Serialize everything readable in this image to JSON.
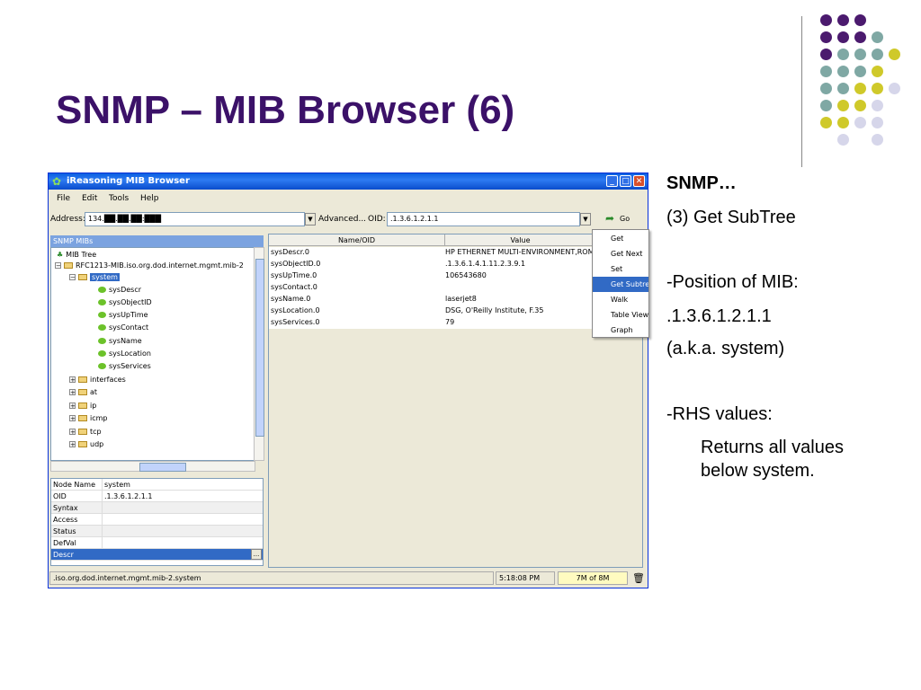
{
  "slide": {
    "title": "SNMP – MIB Browser (6)",
    "notes": {
      "heading": "SNMP…",
      "step": "(3) Get SubTree",
      "position_label": "-Position of MIB:",
      "position_oid": ".1.3.6.1.2.1.1",
      "aka": "(a.k.a. system)",
      "rhs_label": "-RHS values:",
      "rhs_text_1": "Returns all values",
      "rhs_text_2": "below system."
    },
    "dot_colors": {
      "purple": "#4b1a6e",
      "teal": "#7fa8a4",
      "yellow": "#cfc92a",
      "lavender": "#d6d6ea"
    }
  },
  "window": {
    "title": "iReasoning MIB Browser",
    "menu": [
      "File",
      "Edit",
      "Tools",
      "Help"
    ],
    "address_label": "Address:",
    "address_value": "134.██.██.██:███",
    "advanced_label": "Advanced...",
    "oid_label": "OID:",
    "oid_value": ".1.3.6.1.2.1.1",
    "go_label": "Go",
    "tree_header": "SNMP MIBs",
    "tree": {
      "root": "MIB Tree",
      "module": "RFC1213-MIB.iso.org.dod.internet.mgmt.mib-2",
      "selected": "system",
      "leaves": [
        "sysDescr",
        "sysObjectID",
        "sysUpTime",
        "sysContact",
        "sysName",
        "sysLocation",
        "sysServices"
      ],
      "folders": [
        "interfaces",
        "at",
        "ip",
        "icmp",
        "tcp",
        "udp"
      ]
    },
    "props": [
      {
        "k": "Node Name",
        "v": "system"
      },
      {
        "k": "OID",
        "v": ".1.3.6.1.2.1.1"
      },
      {
        "k": "Syntax",
        "v": ""
      },
      {
        "k": "Access",
        "v": ""
      },
      {
        "k": "Status",
        "v": ""
      },
      {
        "k": "DefVal",
        "v": ""
      },
      {
        "k": "Descr",
        "v": ""
      }
    ],
    "results_columns": [
      "Name/OID",
      "Value"
    ],
    "results": [
      {
        "name": "sysDescr.0",
        "value": "HP ETHERNET MULTI-ENVIRONMENT,ROM"
      },
      {
        "name": "sysObjectID.0",
        "value": ".1.3.6.1.4.1.11.2.3.9.1"
      },
      {
        "name": "sysUpTime.0",
        "value": "106543680"
      },
      {
        "name": "sysContact.0",
        "value": ""
      },
      {
        "name": "sysName.0",
        "value": "laserjet8"
      },
      {
        "name": "sysLocation.0",
        "value": "DSG, O'Reilly Institute, F.35"
      },
      {
        "name": "sysServices.0",
        "value": "79"
      }
    ],
    "context_menu": [
      "Get",
      "Get Next",
      "Set",
      "Get Subtree",
      "Walk",
      "Table View",
      "Graph"
    ],
    "context_selected": "Get Subtree",
    "status_path": ".iso.org.dod.internet.mgmt.mib-2.system",
    "status_time": "5:18:08 PM",
    "status_mem": "7M of 8M"
  }
}
